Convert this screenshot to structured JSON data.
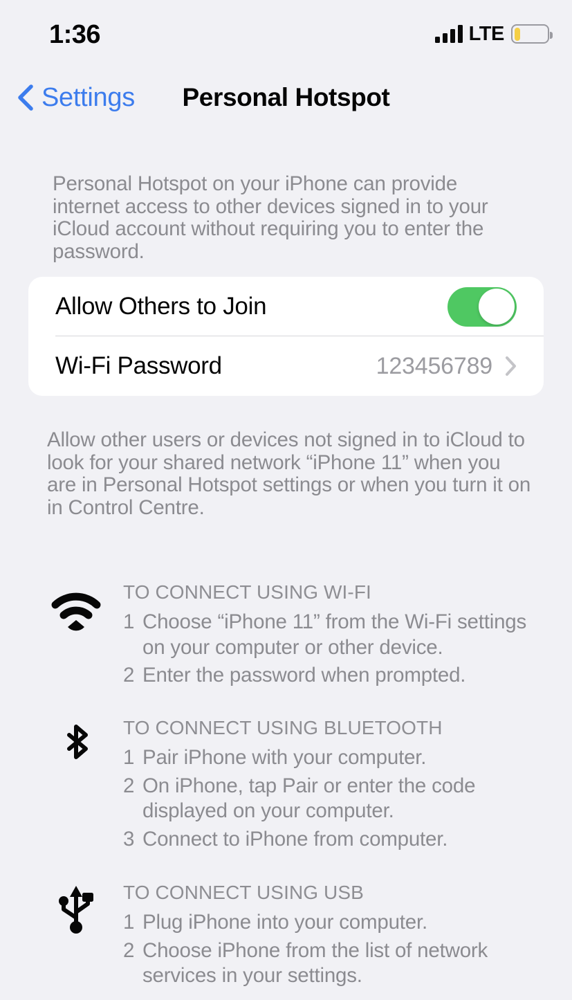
{
  "status_bar": {
    "time": "1:36",
    "carrier_tech": "LTE",
    "signal_bars": 4,
    "battery_percent_fill": 18,
    "battery_color": "#f5cf45"
  },
  "nav": {
    "back_label": "Settings",
    "back_icon": "chevron-left-icon",
    "title": "Personal Hotspot",
    "tint_color": "#3c7ced"
  },
  "intro": {
    "text": "Personal Hotspot on your iPhone can provide internet access to other devices signed in to your iCloud account without requiring you to enter the password."
  },
  "settings": {
    "allow_others": {
      "label": "Allow Others to Join",
      "toggle_on": true,
      "toggle_color": "#4fc862"
    },
    "wifi_password": {
      "label": "Wi-Fi Password",
      "value": "123456789",
      "chevron_icon": "chevron-right-icon"
    }
  },
  "footer_note": {
    "text": "Allow other users or devices not signed in to iCloud to look for your shared network “iPhone 11” when you are in Personal Hotspot settings or when you turn it on in Control Centre."
  },
  "instructions": [
    {
      "id": "wifi",
      "icon": "wifi-icon",
      "heading": "TO CONNECT USING WI-FI",
      "steps": [
        {
          "num": "1",
          "text": "Choose “iPhone 11” from the Wi-Fi settings on your computer or other device."
        },
        {
          "num": "2",
          "text": "Enter the password when prompted."
        }
      ]
    },
    {
      "id": "bluetooth",
      "icon": "bluetooth-icon",
      "heading": "TO CONNECT USING BLUETOOTH",
      "steps": [
        {
          "num": "1",
          "text": "Pair iPhone with your computer."
        },
        {
          "num": "2",
          "text": "On iPhone, tap Pair or enter the code displayed on your computer."
        },
        {
          "num": "3",
          "text": "Connect to iPhone from computer."
        }
      ]
    },
    {
      "id": "usb",
      "icon": "usb-icon",
      "heading": "TO CONNECT USING USB",
      "steps": [
        {
          "num": "1",
          "text": "Plug iPhone into your computer."
        },
        {
          "num": "2",
          "text": "Choose iPhone from the list of network services in your settings."
        }
      ]
    }
  ]
}
